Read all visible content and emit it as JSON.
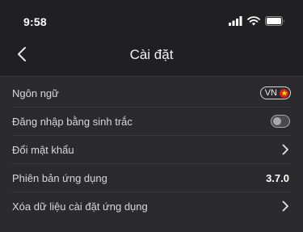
{
  "status_bar": {
    "time": "9:58"
  },
  "header": {
    "title": "Cài đặt"
  },
  "settings": {
    "language": {
      "label": "Ngôn ngữ",
      "value": "VN"
    },
    "biometric": {
      "label": "Đăng nhập bằng sinh trắc",
      "enabled": false
    },
    "change_password": {
      "label": "Đổi mật khẩu"
    },
    "app_version": {
      "label": "Phiên bản ứng dụng",
      "value": "3.7.0"
    },
    "clear_data": {
      "label": "Xóa dữ liệu cài đặt ứng dụng"
    }
  },
  "colors": {
    "background": "#2b2b2d",
    "header": "#202023",
    "flag_red": "#d8251c"
  }
}
